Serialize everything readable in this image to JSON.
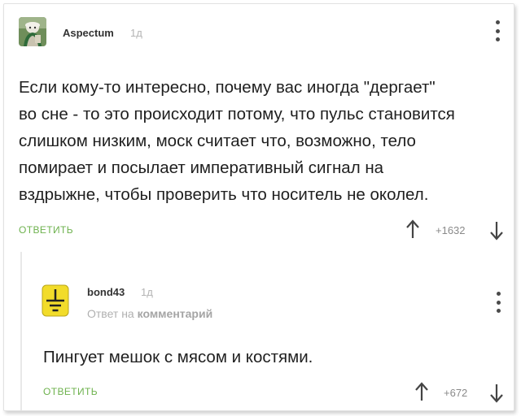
{
  "comment1": {
    "author": "Aspectum",
    "time": "1д",
    "text_lines": [
      "Если кому-то интересно, почему вас иногда \"дергает\"",
      "во сне - то это происходит потому, что пульс становится",
      "слишком низким, моск считает что, возможно, тело",
      "помирает и посылает императивный сигнал на",
      "вздрыжне, чтобы проверить что носитель не околел."
    ],
    "reply_label": "ответить",
    "rating": "+1632"
  },
  "comment2": {
    "author": "bond43",
    "time": "1д",
    "reply_prefix": "Ответ на",
    "reply_target": "комментарий",
    "text": "Пингует мешок с мясом и костями.",
    "reply_label": "ответить",
    "rating": "+672"
  },
  "colors": {
    "accent_green": "#6eb24e",
    "avatar2_yellow": "#f2dc2a"
  },
  "icons": {
    "menu": "vertical-dots-icon",
    "upvote": "arrow-up-icon",
    "downvote": "arrow-down-icon",
    "avatar2": "ground-symbol-icon"
  }
}
